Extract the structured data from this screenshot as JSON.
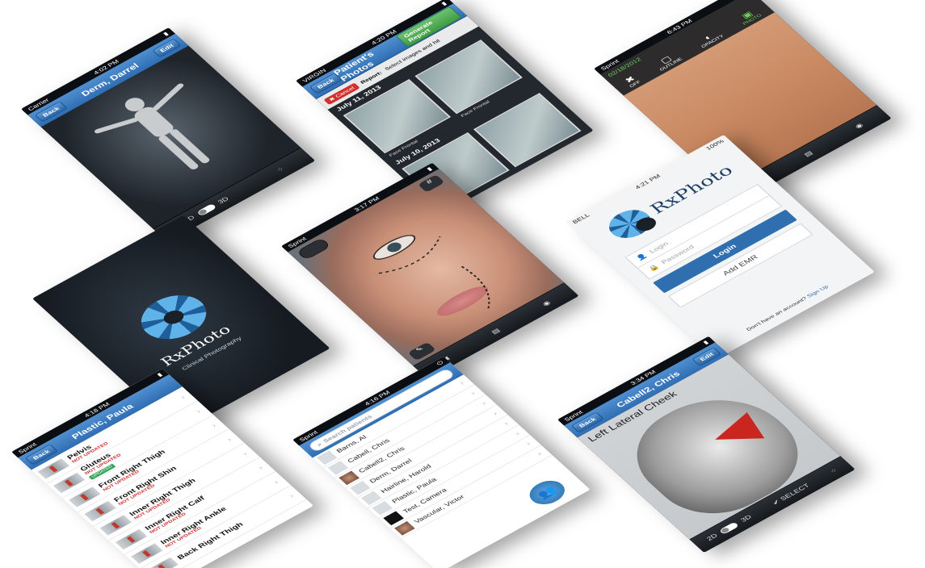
{
  "screens": {
    "body3d": {
      "status_carrier": "Carrier",
      "status_time": "4:02 PM",
      "nav_back": "Back",
      "nav_title": "Derm, Darrel",
      "nav_edit": "Edit",
      "toggle_2d": "2D",
      "toggle_3d": "3D"
    },
    "patient_photos": {
      "status_carrier": "VIRGIN",
      "status_time": "4:20 PM",
      "nav_back": "Back",
      "nav_title": "Patient's Photos",
      "nav_action": "Generate Report",
      "cancel_label": "Cancel",
      "report_hint_bold": "Report:",
      "report_hint": "Select images and hit",
      "groups": [
        {
          "date": "July 11, 2013",
          "captions": [
            "Face  Frontal",
            "Face  Frontal"
          ]
        },
        {
          "date": "July 10, 2013",
          "captions": [
            "",
            ""
          ]
        }
      ]
    },
    "overlay_camera": {
      "status_carrier": "Sprint",
      "status_time": "6:43 PM",
      "date_label": "02/18/2012",
      "options": [
        {
          "icon": "✖",
          "label": "OFF"
        },
        {
          "icon": "▢",
          "label": "OUTLINE"
        },
        {
          "icon": "◐",
          "label": "OPACITY"
        },
        {
          "icon": "▣",
          "label": "PHOTO"
        }
      ]
    },
    "face_markup": {
      "status_carrier": "Sprint",
      "status_time": "3:17 PM"
    },
    "login": {
      "status_carrier": "BELL",
      "status_time": "4:21 PM",
      "status_battery": "100%",
      "brand": "RxPhoto",
      "login_placeholder": "Login",
      "password_placeholder": "Password",
      "login_button": "Login",
      "emr_button": "Add EMR",
      "signup_prompt": "Don't have an account?",
      "signup_link": "Sign Up"
    },
    "splash": {
      "brand": "RxPhoto",
      "tagline": "Clinical Photography"
    },
    "patient_areas": {
      "status_carrier": "Sprint",
      "status_time": "4:18 PM",
      "nav_back": "Back",
      "nav_title": "Plastic, Paula",
      "items": [
        {
          "name": "Pelvis",
          "status": "NOT UPDATED",
          "badge": ""
        },
        {
          "name": "Gluteus",
          "status": "NOT UPDATED",
          "badge": "UPDATED"
        },
        {
          "name": "Front Right Thigh",
          "status": "NOT UPDATED",
          "badge": ""
        },
        {
          "name": "Front Right Shin",
          "status": "NOT UPDATED",
          "badge": ""
        },
        {
          "name": "Inner Right Thigh",
          "status": "NOT UPDATED",
          "badge": ""
        },
        {
          "name": "Inner Right Calf",
          "status": "NOT UPDATED",
          "badge": ""
        },
        {
          "name": "Inner Right Ankle",
          "status": "NOT UPDATED",
          "badge": ""
        },
        {
          "name": "Back Right Thigh",
          "status": "",
          "badge": ""
        }
      ]
    },
    "patients": {
      "status_carrier": "Sprint",
      "status_time": "4:16 PM",
      "search_placeholder": "Search patients",
      "list": [
        "Barns, Al",
        "Cabell, Chris",
        "Cabell2, Chris",
        "Derm, Darrel",
        "Hairline, Harold",
        "Plastic, Paula",
        "Test, Camera",
        "Vascular, Victor"
      ]
    },
    "head3d": {
      "status_carrier": "Sprint",
      "status_time": "3:34 PM",
      "nav_back": "Back",
      "nav_title": "Cabell2, Chris",
      "nav_edit": "Edit",
      "region_label": "Left Lateral Cheek",
      "select_label": "SELECT",
      "toggle_2d": "2D",
      "toggle_3d": "3D"
    }
  },
  "colors": {
    "nav_blue": "#3a7cc1",
    "accent_green": "#4caf50",
    "alert_red": "#d0312d",
    "cheek_red": "#c9261f"
  }
}
